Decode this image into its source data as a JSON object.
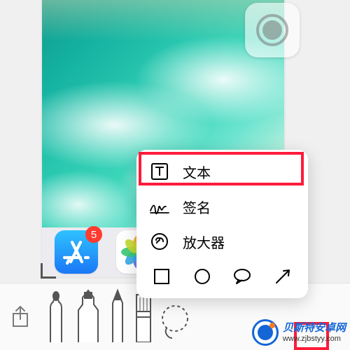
{
  "dock": {
    "appstore": {
      "name": "App Store",
      "badge": "5"
    },
    "photos": {
      "name": "Photos"
    }
  },
  "popup": {
    "text_label": "文本",
    "signature_label": "签名",
    "magnifier_label": "放大器"
  },
  "watermark": {
    "title": "贝斯特安卓网",
    "url": "www.zjbstyy.com"
  },
  "petal_colors": [
    "#f6a623",
    "#f45c3a",
    "#e7407f",
    "#b14bd4",
    "#5f6ee7",
    "#34a9e4",
    "#3bc774",
    "#c4d92d"
  ]
}
